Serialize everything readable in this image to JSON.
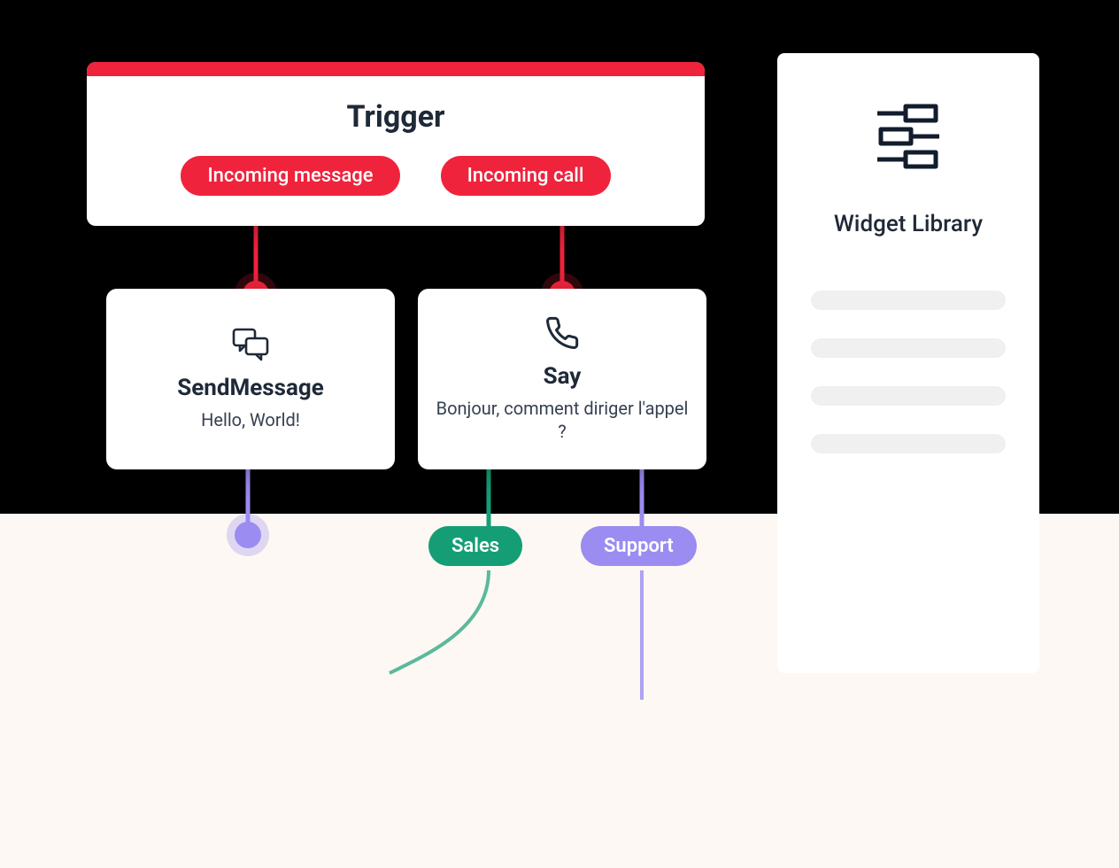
{
  "colors": {
    "red": "#ef233c",
    "green": "#159e76",
    "purple": "#9a8cf0"
  },
  "trigger": {
    "title": "Trigger",
    "pills": {
      "message": "Incoming message",
      "call": "Incoming call"
    }
  },
  "widgets": {
    "send": {
      "title": "SendMessage",
      "body": "Hello, World!"
    },
    "say": {
      "title": "Say",
      "body": "Bonjour, comment diriger l'appel ?"
    }
  },
  "branches": {
    "sales": "Sales",
    "support": "Support"
  },
  "library": {
    "title": "Widget Library"
  }
}
